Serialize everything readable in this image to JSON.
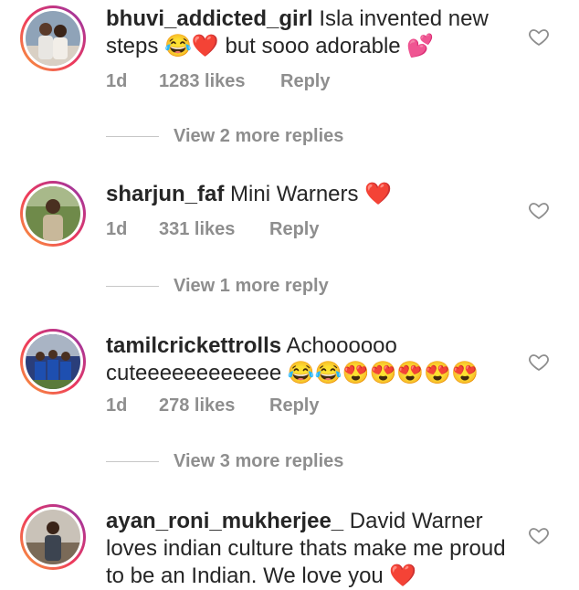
{
  "comments": [
    {
      "username": "bhuvi_addicted_girl",
      "text": " Isla invented new steps 😂❤️ but sooo adorable 💕",
      "time": "1d",
      "likes": "1283 likes",
      "reply": "Reply",
      "view_replies": "View 2 more replies"
    },
    {
      "username": "sharjun_faf",
      "text": " Mini Warners ❤️",
      "time": "1d",
      "likes": "331 likes",
      "reply": "Reply",
      "view_replies": "View 1 more reply"
    },
    {
      "username": "tamilcrickettrolls",
      "text": " Achoooooo cuteeeeeeeeeeee 😂😂😍😍😍😍😍",
      "time": "1d",
      "likes": "278 likes",
      "reply": "Reply",
      "view_replies": "View 3 more replies"
    },
    {
      "username": "ayan_roni_mukherjee_",
      "text": " David Warner loves indian culture thats make me proud to be an Indian. We love you ❤️"
    }
  ],
  "icons": {
    "like": "heart-outline-icon"
  },
  "colors": {
    "meta": "#8e8e8e",
    "text": "#262626",
    "ring_start": "#f9a23a",
    "ring_end": "#833ab4"
  }
}
